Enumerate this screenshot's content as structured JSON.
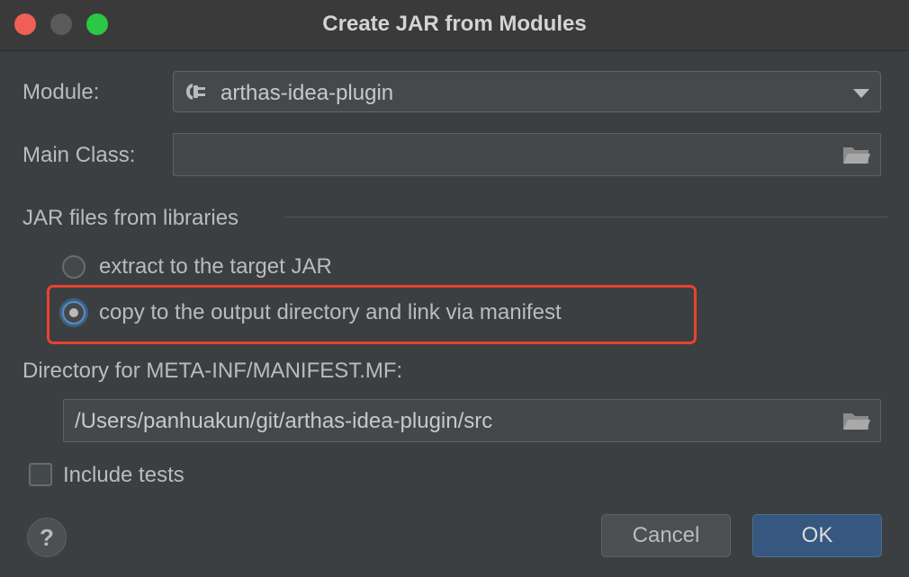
{
  "window": {
    "title": "Create JAR from Modules"
  },
  "module": {
    "label": "Module:",
    "value": "arthas-idea-plugin",
    "icon": "plugin-module-icon"
  },
  "main_class": {
    "label": "Main Class:",
    "value": "",
    "icon": "folder-icon"
  },
  "libraries": {
    "section_title": "JAR files from libraries",
    "options": [
      {
        "label": "extract to the target JAR",
        "selected": false
      },
      {
        "label": "copy to the output directory and link via manifest",
        "selected": true
      }
    ]
  },
  "manifest": {
    "label": "Directory for META-INF/MANIFEST.MF:",
    "value": "/Users/panhuakun/git/arthas-idea-plugin/src",
    "icon": "folder-icon"
  },
  "include_tests": {
    "label": "Include tests",
    "checked": false
  },
  "footer": {
    "help_label": "?",
    "cancel_label": "Cancel",
    "ok_label": "OK"
  },
  "colors": {
    "background": "#3c3f41",
    "highlight_border": "#e84232",
    "primary_button": "#365880",
    "selected_radio_ring": "#5c8dc4"
  }
}
